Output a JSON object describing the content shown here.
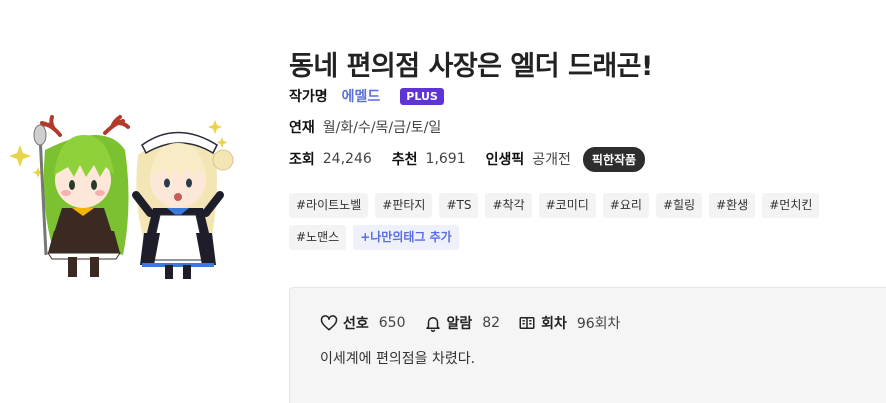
{
  "work": {
    "title": "동네 편의점 사장은 엘더 드래곤!"
  },
  "author": {
    "label": "작가명",
    "name": "에멜드",
    "badge": "PLUS"
  },
  "serial": {
    "label": "연재",
    "days": "월/화/수/목/금/토/일"
  },
  "stats": {
    "views_label": "조회",
    "views": "24,246",
    "recommend_label": "추천",
    "recommend": "1,691",
    "life_pick_label": "인생픽",
    "life_pick": "공개전",
    "pick_badge": "픽한작품"
  },
  "tags": [
    "#라이트노벨",
    "#판타지",
    "#TS",
    "#착각",
    "#코미디",
    "#요리",
    "#힐링",
    "#환생",
    "#먼치킨",
    "#노맨스"
  ],
  "tag_add": "+나만의태그 추가",
  "counts": {
    "favorite_label": "선호",
    "favorite": "650",
    "alarm_label": "알람",
    "alarm": "82",
    "episodes_label": "회차",
    "episodes": "96회차"
  },
  "synopsis": "이세계에 편의점을 차렸다.",
  "colors": {
    "accent": "#5b6ee1",
    "plus_badge": "#5e35d4",
    "pick_badge": "#2d2d2d",
    "tag_bg": "#f3f3f3",
    "info_bg": "#f5f5f5"
  }
}
